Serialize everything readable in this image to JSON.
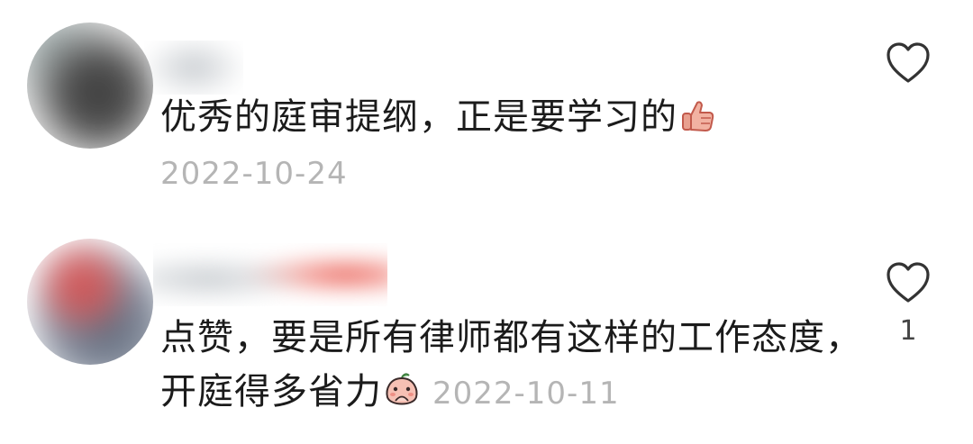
{
  "comments": [
    {
      "text": "优秀的庭审提纲，正是要学习的",
      "emoji": "thumbs-up-emoji",
      "date": "2022-10-24",
      "like_count": ""
    },
    {
      "line1": "点赞，要是所有律师都有这样的工作态度，",
      "line2": "开庭得多省力",
      "emoji": "peach-covering-mouth-emoji",
      "date": "2022-10-11",
      "like_count": "1"
    }
  ],
  "colors": {
    "text": "#1b1b1b",
    "date": "#b5b5b5",
    "heart_outline": "#333333"
  }
}
